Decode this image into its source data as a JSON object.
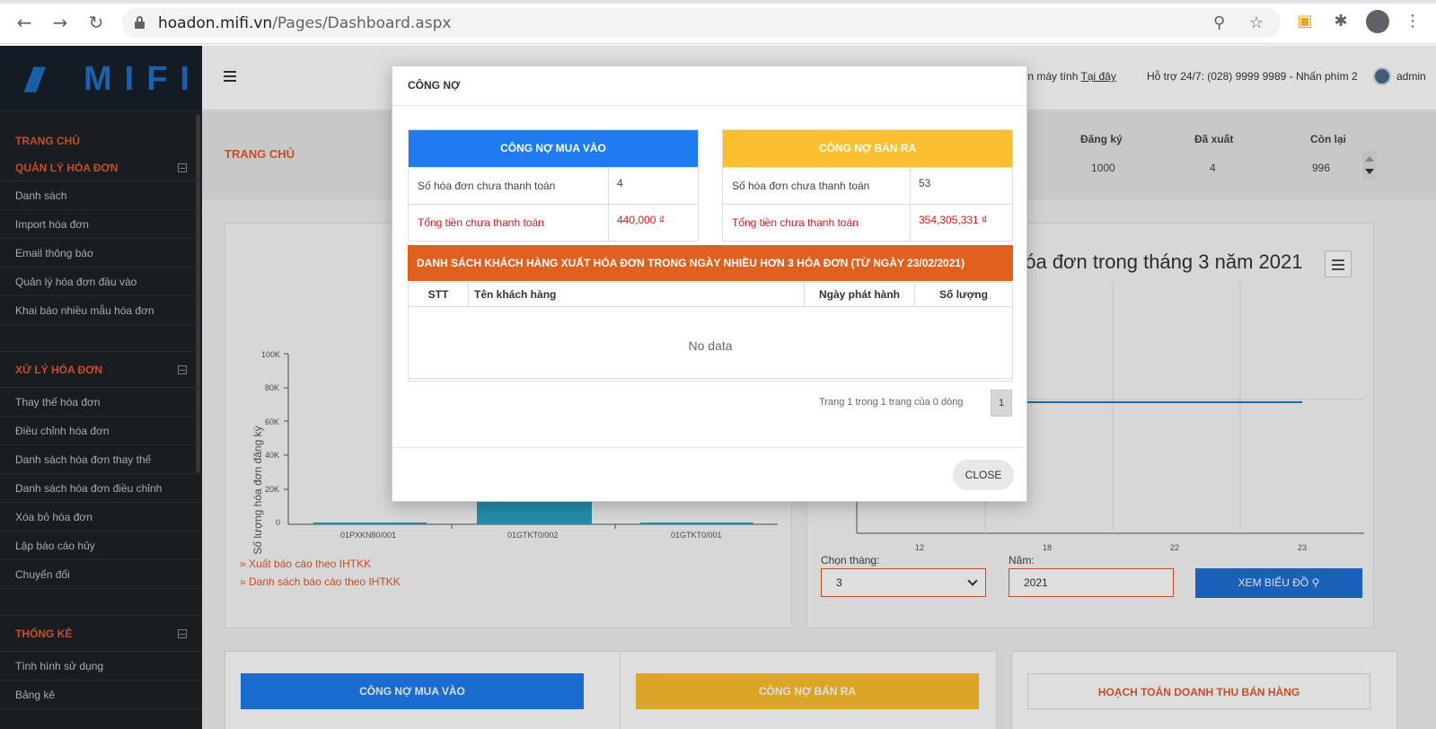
{
  "browser": {
    "url_host": "hoadon.mifi.vn",
    "url_path": "/Pages/Dashboard.aspx"
  },
  "sidebar": {
    "logo_text": "MIFI",
    "home": "TRANG CHỦ",
    "sections": [
      {
        "title": "QUẢN LÝ HÓA ĐƠN",
        "items": [
          "Danh sách",
          "Import hóa đơn",
          "Email thông báo",
          "Quản lý hóa đơn đầu vào",
          "Khai báo nhiều mẫu hóa đơn"
        ]
      },
      {
        "title": "XỬ LÝ HÓA ĐƠN",
        "items": [
          "Thay thế hóa đơn",
          "Điều chỉnh hóa đơn",
          "Danh sách hóa đơn thay thế",
          "Danh sách hóa đơn điều chỉnh",
          "Xóa bỏ hóa đơn",
          "Lập báo cáo hủy",
          "Chuyển đổi"
        ]
      },
      {
        "title": "THỐNG KÊ",
        "items": [
          "Tình hình sử dụng",
          "Bảng kê"
        ]
      }
    ]
  },
  "topbar": {
    "help_text": "iển máy tính",
    "help_link": "Tại đây",
    "support": "Hỗ trợ 24/7: (028) 9999 9989 - Nhấn phím 2",
    "user": "admin"
  },
  "breadcrumb": "TRANG CHỦ",
  "stats": {
    "headers": [
      "Đăng ký",
      "Đã xuất",
      "Còn lại"
    ],
    "values": [
      "1000",
      "4",
      "996"
    ]
  },
  "left_chart": {
    "ylabel": "Số lượng hóa đơn đăng ký",
    "yticks": [
      "100K",
      "80K",
      "60K",
      "40K",
      "20K",
      "0"
    ],
    "categories": [
      "01PXKN80/001",
      "01GTKT0/002",
      "01GTKT0/001"
    ],
    "links": [
      "Xuất báo cáo theo IHTKK",
      "Danh sách báo cáo theo IHTKK"
    ]
  },
  "right_chart": {
    "title": "hóa đơn trong tháng 3 năm 2021",
    "xticks": [
      "12",
      "18",
      "22",
      "23"
    ],
    "month_label": "Chọn tháng:",
    "month_value": "3",
    "year_label": "Năm:",
    "year_value": "2021",
    "view_button": "XEM BIỂU ĐỒ"
  },
  "bottom": {
    "buy": "CÔNG NỢ MUA VÀO",
    "sell": "CÔNG NỢ BÁN RA",
    "revenue": "HOẠCH TOÁN DOANH THU BÁN HÀNG"
  },
  "modal": {
    "title": "CÔNG NỢ",
    "buy": {
      "header": "CÔNG NỢ MUA VÀO",
      "unpaid_label": "Số hóa đơn chưa thanh toán",
      "unpaid_value": "4",
      "total_label": "Tổng tiền chưa thanh toán",
      "total_value": "440,000 ₫"
    },
    "sell": {
      "header": "CÔNG NỢ BÁN RA",
      "unpaid_label": "Số hóa đơn chưa thanh toán",
      "unpaid_value": "53",
      "total_label": "Tổng tiền chưa thanh toán",
      "total_value": "354,305,331 ₫"
    },
    "customers_header": "DANH SÁCH KHÁCH HÀNG XUẤT HÓA ĐƠN TRONG NGÀY NHIỀU HƠN 3 HÓA ĐƠN (TỪ NGÀY 23/02/2021)",
    "columns": [
      "STT",
      "Tên khách hàng",
      "Ngày phát hành",
      "Số lượng"
    ],
    "no_data": "No data",
    "pager_text": "Trang 1 trong 1 trang của 0 dòng",
    "page": "1",
    "close": "CLOSE"
  },
  "colors": {
    "blue": "#1f7cf0",
    "yellow": "#fcbf2e",
    "orange": "#e0601f",
    "red_text": "#e0161b"
  }
}
